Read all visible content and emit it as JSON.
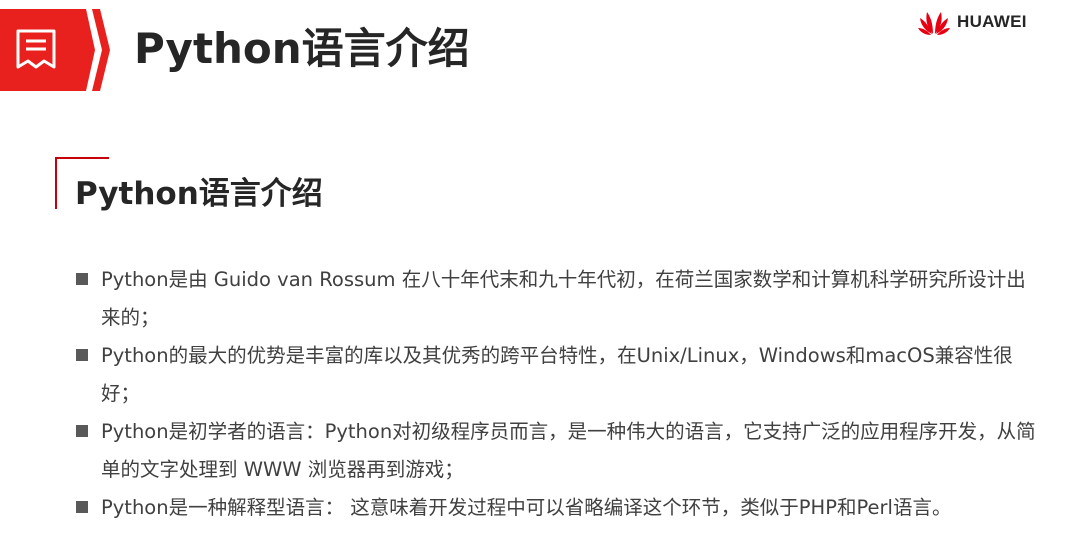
{
  "header": {
    "title": "Python语言介绍",
    "icon": "document-list-icon",
    "accent_color": "#e8201e"
  },
  "brand": {
    "name": "HUAWEI",
    "logo": "huawei-petal-logo",
    "logo_color": "#e60012"
  },
  "section": {
    "title": "Python语言介绍",
    "corner_color": "#c7000b"
  },
  "bullets": [
    {
      "text": "Python是由 Guido van Rossum 在八十年代末和九十年代初，在荷兰国家数学和计算机科学研究所设计出来的；"
    },
    {
      "text": "Python的最大的优势是丰富的库以及其优秀的跨平台特性，在Unix/Linux，Windows和macOS兼容性很好；"
    },
    {
      "text": "Python是初学者的语言：Python对初级程序员而言，是一种伟大的语言，它支持广泛的应用程序开发，从简单的文字处理到 WWW 浏览器再到游戏；"
    },
    {
      "text": "Python是一种解释型语言： 这意味着开发过程中可以省略编译这个环节，类似于PHP和Perl语言。"
    }
  ]
}
